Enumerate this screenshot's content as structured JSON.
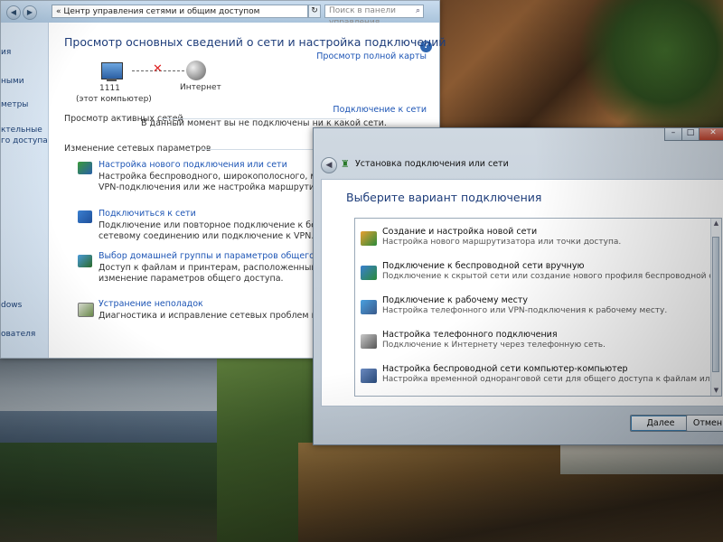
{
  "nsc": {
    "address": "« Центр управления сетями и общим доступом",
    "search_placeholder": "Поиск в панели управления",
    "sidebar": [
      "ия",
      "ными",
      "метры",
      "ктельные",
      "го доступа",
      "dows",
      "ователя"
    ],
    "title": "Просмотр основных сведений о сети и настройка подключений",
    "map_link": "Просмотр полной карты",
    "computer_name": "1111",
    "computer_sub": "(этот компьютер)",
    "internet_label": "Интернет",
    "active_networks": "Просмотр активных сетей",
    "connect_link": "Подключение к сети",
    "not_connected": "В данный момент вы не подключены ни к какой сети.",
    "change_settings": "Изменение сетевых параметров",
    "tasks": [
      {
        "title": "Настройка нового подключения или сети",
        "desc1": "Настройка беспроводного, широкополосного, модемного",
        "desc2": "VPN-подключения или же настройка маршрутизатора или"
      },
      {
        "title": "Подключиться к сети",
        "desc1": "Подключение или повторное подключение к беспроводн",
        "desc2": "сетевому соединению или подключение к VPN."
      },
      {
        "title": "Выбор домашней группы и параметров общего доступа",
        "desc1": "Доступ к файлам и принтерам, расположенным на других",
        "desc2": "изменение параметров общего доступа."
      },
      {
        "title": "Устранение неполадок",
        "desc1": "Диагностика и исправление сетевых проблем или получен",
        "desc2": ""
      }
    ]
  },
  "dialog": {
    "title": "Установка подключения или сети",
    "heading": "Выберите вариант подключения",
    "options": [
      {
        "title": "Создание и настройка новой сети",
        "desc": "Настройка нового маршрутизатора или точки доступа."
      },
      {
        "title": "Подключение к беспроводной сети вручную",
        "desc": "Подключение к скрытой сети или создание нового профиля беспроводной связи."
      },
      {
        "title": "Подключение к рабочему месту",
        "desc": "Настройка телефонного или VPN-подключения к рабочему месту."
      },
      {
        "title": "Настройка телефонного подключения",
        "desc": "Подключение к Интернету через телефонную сеть."
      },
      {
        "title": "Настройка беспроводной сети компьютер-компьютер",
        "desc": "Настройка временной одноранговой сети для общего доступа к файлам или к Инт..."
      }
    ],
    "next_label": "Далее",
    "cancel_label": "Отмен"
  },
  "colors": {
    "link": "#1d55b5",
    "heading": "#1e3d7a"
  }
}
